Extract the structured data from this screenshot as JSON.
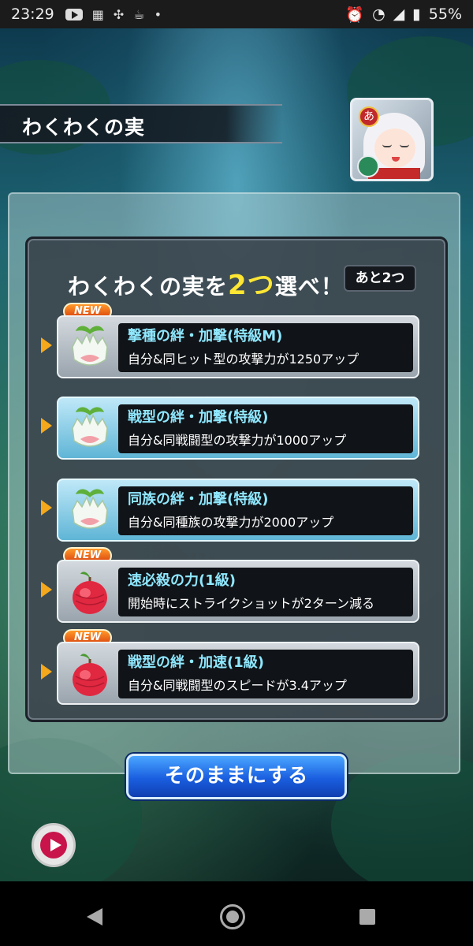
{
  "status_bar": {
    "time": "23:29",
    "battery": "55%",
    "dot": "•",
    "icons": [
      "youtube-icon",
      "calendar-icon",
      "pinwheel-icon",
      "coffee-icon",
      "alarm-icon",
      "wifi-icon",
      "signal-icon",
      "battery-icon"
    ]
  },
  "header": {
    "title": "わくわくの実"
  },
  "avatar": {
    "badge_glyph": "あ"
  },
  "panel": {
    "title_prefix": "わくわくの実を",
    "title_count": "2つ",
    "title_suffix": "選べ！",
    "remaining": "あと2つ"
  },
  "options": [
    {
      "name": "撃種の絆・加撃(特級M)",
      "desc": "自分&同ヒット型の攻撃力が1250アップ",
      "new": "NEW",
      "style": "grey",
      "fruit": "white-fruit-icon"
    },
    {
      "name": "戦型の絆・加撃(特級)",
      "desc": "自分&同戦闘型の攻撃力が1000アップ",
      "new": "",
      "style": "blue",
      "fruit": "white-fruit-icon"
    },
    {
      "name": "同族の絆・加撃(特級)",
      "desc": "自分&同種族の攻撃力が2000アップ",
      "new": "",
      "style": "blue",
      "fruit": "white-fruit-icon"
    },
    {
      "name": "速必殺の力(1級)",
      "desc": "開始時にストライクショットが2ターン減る",
      "new": "NEW",
      "style": "grey",
      "fruit": "red-fruit-icon"
    },
    {
      "name": "戦型の絆・加速(1級)",
      "desc": "自分&同戦闘型のスピードが3.4アップ",
      "new": "NEW",
      "style": "grey",
      "fruit": "red-fruit-icon"
    }
  ],
  "buttons": {
    "leave_as_is": "そのままにする"
  },
  "colors": {
    "accent_yellow": "#ffe633",
    "option_name": "#8fe8ff",
    "new_badge": "#e8601a",
    "button_blue": "#1a5ee0"
  }
}
